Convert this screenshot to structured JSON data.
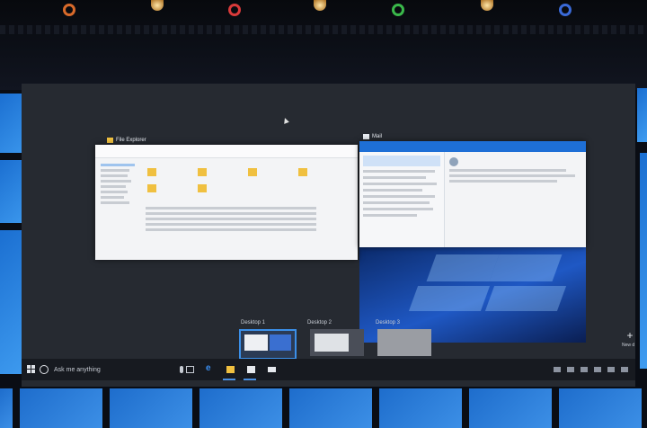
{
  "windows": {
    "file_explorer": {
      "title": "File Explorer"
    },
    "mail": {
      "title": "Mail"
    }
  },
  "desktops": [
    {
      "label": "Desktop 1",
      "active": true
    },
    {
      "label": "Desktop 2",
      "active": false
    },
    {
      "label": "Desktop 3",
      "active": false
    }
  ],
  "new_desktop": {
    "label": "New desktop"
  },
  "taskbar": {
    "search_placeholder": "Ask me anything"
  },
  "icons": {
    "start": "windows-logo-icon",
    "search": "cortana-circle-icon",
    "mic": "microphone-icon",
    "task_view": "task-view-icon",
    "edge": "edge-browser-icon",
    "explorer": "folder-icon",
    "store": "store-icon",
    "mail": "mail-icon",
    "add": "plus-icon"
  },
  "colors": {
    "accent": "#1e6fd6",
    "taskbar": "#171a20",
    "screen": "#262a31"
  }
}
